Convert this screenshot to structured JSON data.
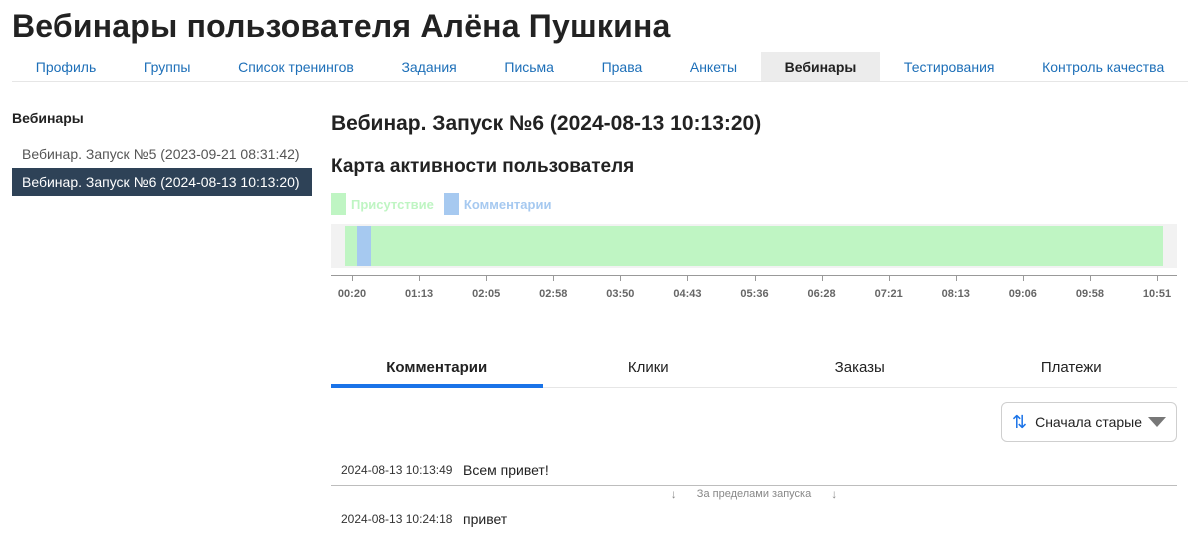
{
  "page": {
    "title": "Вебинары пользователя Алёна Пушкина"
  },
  "top_nav": [
    {
      "label": "Профиль",
      "active": false
    },
    {
      "label": "Группы",
      "active": false
    },
    {
      "label": "Список тренингов",
      "active": false
    },
    {
      "label": "Задания",
      "active": false
    },
    {
      "label": "Письма",
      "active": false
    },
    {
      "label": "Права",
      "active": false
    },
    {
      "label": "Анкеты",
      "active": false
    },
    {
      "label": "Вебинары",
      "active": true
    },
    {
      "label": "Тестирования",
      "active": false
    },
    {
      "label": "Контроль качества",
      "active": false
    }
  ],
  "sidebar": {
    "title": "Вебинары",
    "items": [
      {
        "label": "Вебинар. Запуск №5 (2023-09-21 08:31:42)",
        "active": false
      },
      {
        "label": "Вебинар. Запуск №6 (2024-08-13 10:13:20)",
        "active": true
      }
    ]
  },
  "main": {
    "webinar_title": "Вебинар. Запуск №6 (2024-08-13 10:13:20)",
    "activity_map": {
      "title": "Карта активности пользователя",
      "legend": [
        {
          "label": "Присутствие",
          "color": "#bff5c3"
        },
        {
          "label": "Комментарии",
          "color": "#a6c9f0"
        }
      ],
      "tick_labels": [
        "00:20",
        "01:13",
        "02:05",
        "02:58",
        "03:50",
        "04:43",
        "05:36",
        "06:28",
        "07:21",
        "08:13",
        "09:06",
        "09:58",
        "10:51"
      ],
      "presence_fraction": {
        "start": 0.017,
        "end": 0.984
      },
      "comment_fraction": {
        "start": 0.031,
        "end": 0.047
      }
    },
    "tabs": [
      {
        "label": "Комментарии",
        "active": true
      },
      {
        "label": "Клики",
        "active": false
      },
      {
        "label": "Заказы",
        "active": false
      },
      {
        "label": "Платежи",
        "active": false
      }
    ],
    "sort": {
      "label": "Сначала старые",
      "icon": "sort-arrows-icon"
    },
    "comments": [
      {
        "time": "2024-08-13 10:13:49",
        "text": "Всем привет!"
      },
      {
        "time": "2024-08-13 10:24:18",
        "text": "привет"
      }
    ],
    "separator_text": "За пределами запуска"
  },
  "colors": {
    "accent": "#1a73e8",
    "link": "#1d6fb8",
    "sidebar_active": "#2e4257"
  }
}
